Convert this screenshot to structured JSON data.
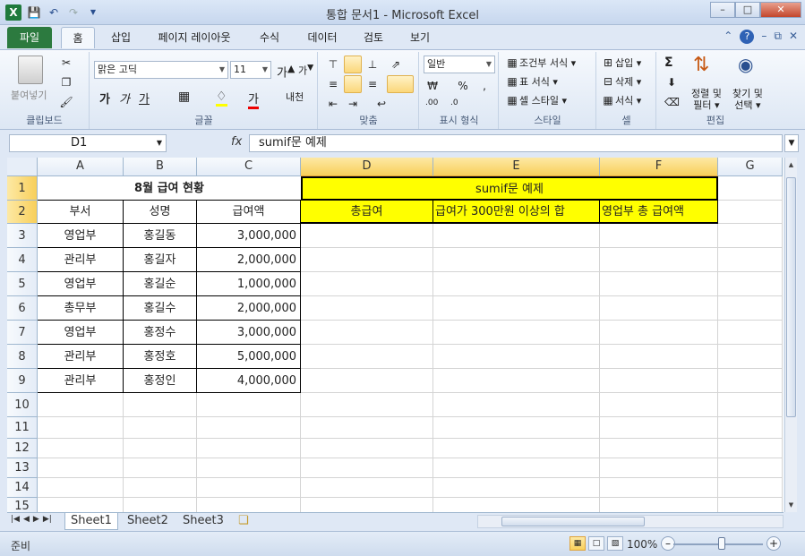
{
  "window": {
    "title": "통합 문서1 - Microsoft Excel"
  },
  "tabs": {
    "file": "파일",
    "items": [
      "홈",
      "삽입",
      "페이지 레이아웃",
      "수식",
      "데이터",
      "검토",
      "보기"
    ]
  },
  "ribbon": {
    "clipboard": {
      "label": "클립보드",
      "paste": "붙여넣기"
    },
    "font": {
      "label": "글꼴",
      "name": "맑은 고딕",
      "size": "11"
    },
    "alignment": {
      "label": "맞춤"
    },
    "number": {
      "label": "표시 형식",
      "format": "일반"
    },
    "styles": {
      "label": "스타일",
      "conditional": "조건부 서식",
      "table": "표 서식",
      "cell": "셀 스타일"
    },
    "cells": {
      "label": "셀",
      "insert": "삽입",
      "delete": "삭제",
      "format": "서식"
    },
    "editing": {
      "label": "편집",
      "sort": "정렬 및",
      "sort2": "필터",
      "find": "찾기 및",
      "find2": "선택"
    }
  },
  "formula_bar": {
    "name_box": "D1",
    "content": "sumif문 예제"
  },
  "columns": [
    "A",
    "B",
    "C",
    "D",
    "E",
    "F",
    "G"
  ],
  "rows": [
    "1",
    "2",
    "3",
    "4",
    "5",
    "6",
    "7",
    "8",
    "9",
    "10",
    "11",
    "12",
    "13",
    "14",
    "15"
  ],
  "sheet": {
    "title": "8월 급여 현황",
    "headers": [
      "부서",
      "성명",
      "급여액"
    ],
    "data": [
      [
        "영업부",
        "홍길동",
        "3,000,000"
      ],
      [
        "관리부",
        "홍길자",
        "2,000,000"
      ],
      [
        "영업부",
        "홍길순",
        "1,000,000"
      ],
      [
        "총무부",
        "홍길수",
        "2,000,000"
      ],
      [
        "영업부",
        "홍정수",
        "3,000,000"
      ],
      [
        "관리부",
        "홍정호",
        "5,000,000"
      ],
      [
        "관리부",
        "홍정인",
        "4,000,000"
      ]
    ],
    "example_title": "sumif문 예제",
    "example_headers": [
      "총급여",
      "급여가 300만원 이상의 합",
      "영업부 총 급여액"
    ]
  },
  "sheet_tabs": [
    "Sheet1",
    "Sheet2",
    "Sheet3"
  ],
  "status": {
    "ready": "준비",
    "zoom": "100%"
  },
  "colors": {
    "highlight": "#ffff00",
    "file_tab": "#2c7a3f",
    "selected_header": "#f8cf5a"
  }
}
